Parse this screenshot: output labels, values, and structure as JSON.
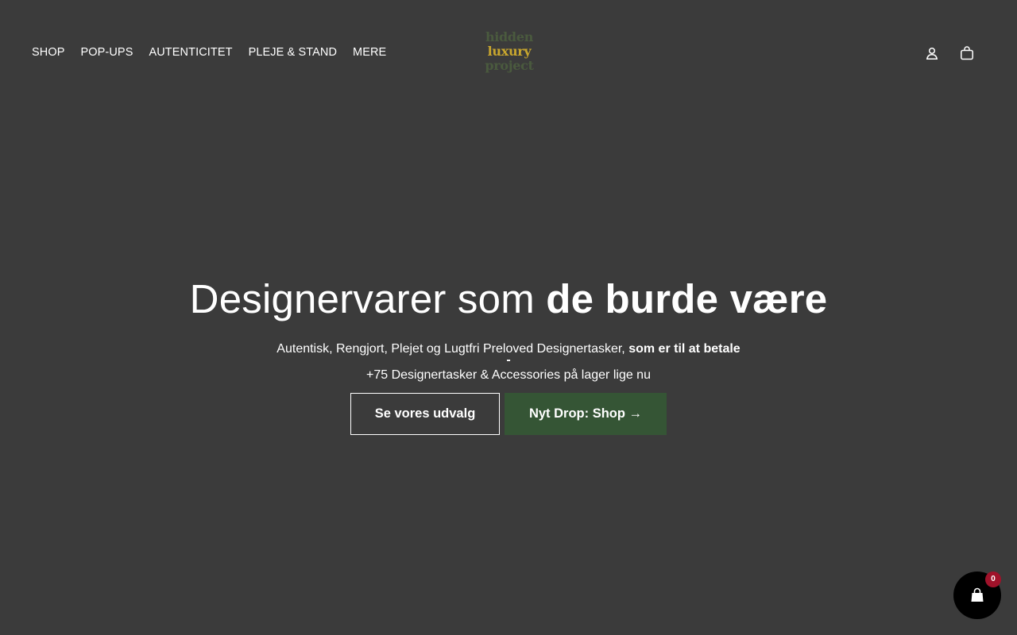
{
  "header": {
    "nav": [
      {
        "label": "SHOP"
      },
      {
        "label": "POP-UPS"
      },
      {
        "label": "AUTENTICITET"
      },
      {
        "label": "PLEJE & STAND"
      },
      {
        "label": "MERE"
      }
    ],
    "logo": {
      "line1": "hidden",
      "line2": "luxury",
      "line3": "project"
    },
    "icons": {
      "account": "user-icon",
      "cart": "bag-icon"
    }
  },
  "hero": {
    "title_regular": "Designervarer som ",
    "title_bold": "de burde være",
    "subtitle_regular": "Autentisk, Rengjort, Plejet og Lugtfri Preloved Designertasker, ",
    "subtitle_bold": "som er til at betale",
    "dash": "-",
    "stock_line": "+75 Designertasker & Accessories på lager lige nu",
    "button_primary": "Se vores udvalg",
    "button_secondary": "Nyt Drop: Shop →"
  },
  "floating_cart": {
    "icon": "shopping-bag-icon",
    "count": "0"
  },
  "colors": {
    "background": "#3b3b3b",
    "accent_green": "#355535",
    "logo_gold": "#c8a62e",
    "logo_green": "#4a5a3e",
    "badge_red": "#a0122a"
  }
}
